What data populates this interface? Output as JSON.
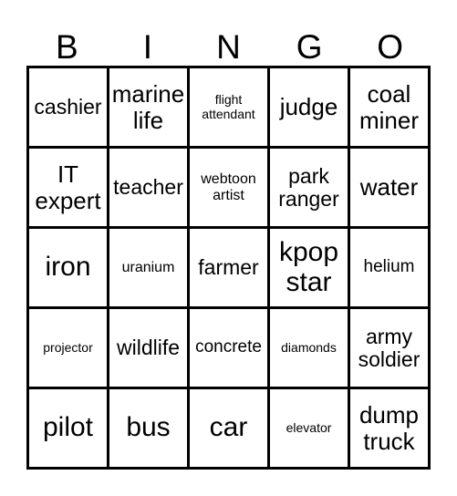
{
  "card": {
    "title": "BINGO",
    "header_letters": [
      "B",
      "I",
      "N",
      "G",
      "O"
    ],
    "columns": 5,
    "rows": 5,
    "colors": {
      "border": "#000000",
      "text": "#000000",
      "background": "#ffffff"
    },
    "grid": [
      [
        {
          "label": "cashier",
          "size": "md"
        },
        {
          "label": "marine life",
          "size": "lg"
        },
        {
          "label": "flight attendant",
          "size": "xxs"
        },
        {
          "label": "judge",
          "size": "lg"
        },
        {
          "label": "coal miner",
          "size": "lg"
        }
      ],
      [
        {
          "label": "IT expert",
          "size": "lg"
        },
        {
          "label": "teacher",
          "size": "md"
        },
        {
          "label": "webtoon artist",
          "size": "xs"
        },
        {
          "label": "park ranger",
          "size": "md"
        },
        {
          "label": "water",
          "size": "lg"
        }
      ],
      [
        {
          "label": "iron",
          "size": "xl"
        },
        {
          "label": "uranium",
          "size": "xs"
        },
        {
          "label": "farmer",
          "size": "md"
        },
        {
          "label": "kpop star",
          "size": "xl"
        },
        {
          "label": "helium",
          "size": "sm"
        }
      ],
      [
        {
          "label": "projector",
          "size": "xxs"
        },
        {
          "label": "wildlife",
          "size": "md"
        },
        {
          "label": "concrete",
          "size": "sm"
        },
        {
          "label": "diamonds",
          "size": "xxs"
        },
        {
          "label": "army soldier",
          "size": "md"
        }
      ],
      [
        {
          "label": "pilot",
          "size": "xl"
        },
        {
          "label": "bus",
          "size": "xl"
        },
        {
          "label": "car",
          "size": "xl"
        },
        {
          "label": "elevator",
          "size": "xxs"
        },
        {
          "label": "dump truck",
          "size": "lg"
        }
      ]
    ]
  }
}
